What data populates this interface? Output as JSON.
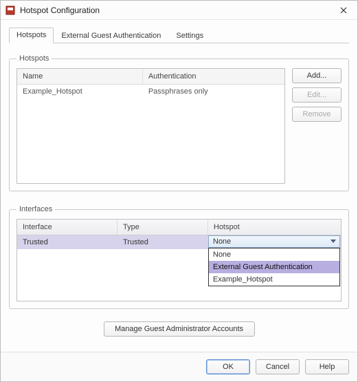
{
  "window": {
    "title": "Hotspot Configuration"
  },
  "tabs": {
    "hotspots": "Hotspots",
    "external": "External Guest Authentication",
    "settings": "Settings"
  },
  "hotspots_group": {
    "legend": "Hotspots",
    "columns": {
      "name": "Name",
      "auth": "Authentication"
    },
    "rows": [
      {
        "name": "Example_Hotspot",
        "auth": "Passphrases only"
      }
    ],
    "buttons": {
      "add": "Add...",
      "edit": "Edit...",
      "remove": "Remove"
    }
  },
  "interfaces_group": {
    "legend": "Interfaces",
    "columns": {
      "iface": "Interface",
      "type": "Type",
      "hotspot": "Hotspot"
    },
    "row": {
      "iface": "Trusted",
      "type": "Trusted"
    },
    "combo_value": "None",
    "options": [
      "None",
      "External Guest Authentication",
      "Example_Hotspot"
    ],
    "selected_option_index": 1
  },
  "manage_button": "Manage Guest Administrator Accounts",
  "footer": {
    "ok": "OK",
    "cancel": "Cancel",
    "help": "Help"
  }
}
